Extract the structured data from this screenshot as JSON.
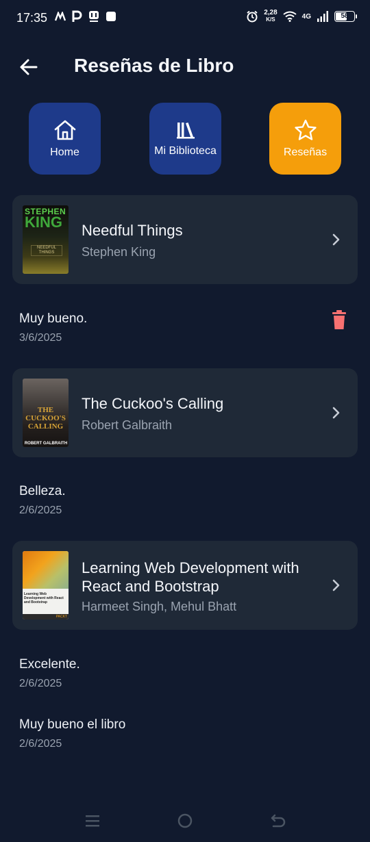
{
  "status": {
    "time": "17:35",
    "speed_top": "2,28",
    "speed_unit": "K/S",
    "network": "4G",
    "battery": "58"
  },
  "appbar": {
    "title": "Reseñas de Libro"
  },
  "nav": [
    {
      "label": "Home",
      "icon": "home-icon"
    },
    {
      "label": "Mi Biblioteca",
      "icon": "library-icon"
    },
    {
      "label": "Reseñas",
      "icon": "star-icon"
    }
  ],
  "colors": {
    "accent": "#f59e0b",
    "nav_button": "#1e3a8a",
    "card": "#1f2937",
    "background": "#111a2e",
    "delete": "#f87171"
  },
  "books": [
    {
      "title": "Needful Things",
      "author": "Stephen King",
      "cover_text_top": "STEPHEN",
      "cover_text_main": "KING",
      "cover_text_sub": "NEEDFUL THINGS",
      "reviews": [
        {
          "text": "Muy bueno.",
          "date": "3/6/2025"
        }
      ]
    },
    {
      "title": "The Cuckoo's Calling",
      "author": "Robert Galbraith",
      "cover_text_main": "THE CUCKOO'S CALLING",
      "cover_text_sub": "ROBERT GALBRAITH",
      "reviews": [
        {
          "text": "Belleza.",
          "date": "2/6/2025"
        }
      ]
    },
    {
      "title_line1": "Learning Web Development with",
      "title_line2": "React and Bootstrap",
      "author": "Harmeet Singh, Mehul Bhatt",
      "cover_text_main": "Learning Web Development with React and Bootstrap",
      "cover_text_sub": "PACKT",
      "reviews": [
        {
          "text": "Excelente.",
          "date": "2/6/2025"
        },
        {
          "text": "Muy bueno el libro",
          "date": "2/6/2025"
        }
      ]
    }
  ]
}
